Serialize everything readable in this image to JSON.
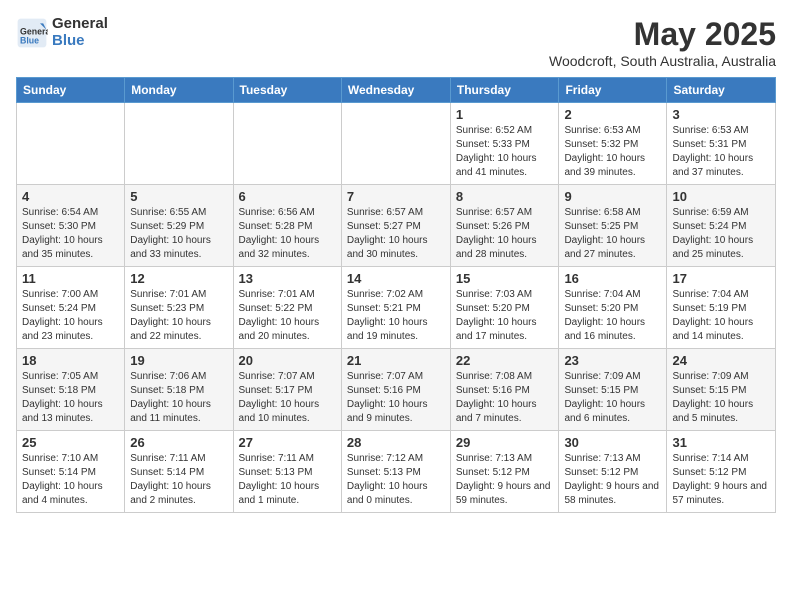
{
  "logo": {
    "line1": "General",
    "line2": "Blue"
  },
  "title": "May 2025",
  "subtitle": "Woodcroft, South Australia, Australia",
  "days": [
    "Sunday",
    "Monday",
    "Tuesday",
    "Wednesday",
    "Thursday",
    "Friday",
    "Saturday"
  ],
  "weeks": [
    [
      {
        "day": "",
        "info": ""
      },
      {
        "day": "",
        "info": ""
      },
      {
        "day": "",
        "info": ""
      },
      {
        "day": "",
        "info": ""
      },
      {
        "day": "1",
        "info": "Sunrise: 6:52 AM\nSunset: 5:33 PM\nDaylight: 10 hours and 41 minutes."
      },
      {
        "day": "2",
        "info": "Sunrise: 6:53 AM\nSunset: 5:32 PM\nDaylight: 10 hours and 39 minutes."
      },
      {
        "day": "3",
        "info": "Sunrise: 6:53 AM\nSunset: 5:31 PM\nDaylight: 10 hours and 37 minutes."
      }
    ],
    [
      {
        "day": "4",
        "info": "Sunrise: 6:54 AM\nSunset: 5:30 PM\nDaylight: 10 hours and 35 minutes."
      },
      {
        "day": "5",
        "info": "Sunrise: 6:55 AM\nSunset: 5:29 PM\nDaylight: 10 hours and 33 minutes."
      },
      {
        "day": "6",
        "info": "Sunrise: 6:56 AM\nSunset: 5:28 PM\nDaylight: 10 hours and 32 minutes."
      },
      {
        "day": "7",
        "info": "Sunrise: 6:57 AM\nSunset: 5:27 PM\nDaylight: 10 hours and 30 minutes."
      },
      {
        "day": "8",
        "info": "Sunrise: 6:57 AM\nSunset: 5:26 PM\nDaylight: 10 hours and 28 minutes."
      },
      {
        "day": "9",
        "info": "Sunrise: 6:58 AM\nSunset: 5:25 PM\nDaylight: 10 hours and 27 minutes."
      },
      {
        "day": "10",
        "info": "Sunrise: 6:59 AM\nSunset: 5:24 PM\nDaylight: 10 hours and 25 minutes."
      }
    ],
    [
      {
        "day": "11",
        "info": "Sunrise: 7:00 AM\nSunset: 5:24 PM\nDaylight: 10 hours and 23 minutes."
      },
      {
        "day": "12",
        "info": "Sunrise: 7:01 AM\nSunset: 5:23 PM\nDaylight: 10 hours and 22 minutes."
      },
      {
        "day": "13",
        "info": "Sunrise: 7:01 AM\nSunset: 5:22 PM\nDaylight: 10 hours and 20 minutes."
      },
      {
        "day": "14",
        "info": "Sunrise: 7:02 AM\nSunset: 5:21 PM\nDaylight: 10 hours and 19 minutes."
      },
      {
        "day": "15",
        "info": "Sunrise: 7:03 AM\nSunset: 5:20 PM\nDaylight: 10 hours and 17 minutes."
      },
      {
        "day": "16",
        "info": "Sunrise: 7:04 AM\nSunset: 5:20 PM\nDaylight: 10 hours and 16 minutes."
      },
      {
        "day": "17",
        "info": "Sunrise: 7:04 AM\nSunset: 5:19 PM\nDaylight: 10 hours and 14 minutes."
      }
    ],
    [
      {
        "day": "18",
        "info": "Sunrise: 7:05 AM\nSunset: 5:18 PM\nDaylight: 10 hours and 13 minutes."
      },
      {
        "day": "19",
        "info": "Sunrise: 7:06 AM\nSunset: 5:18 PM\nDaylight: 10 hours and 11 minutes."
      },
      {
        "day": "20",
        "info": "Sunrise: 7:07 AM\nSunset: 5:17 PM\nDaylight: 10 hours and 10 minutes."
      },
      {
        "day": "21",
        "info": "Sunrise: 7:07 AM\nSunset: 5:16 PM\nDaylight: 10 hours and 9 minutes."
      },
      {
        "day": "22",
        "info": "Sunrise: 7:08 AM\nSunset: 5:16 PM\nDaylight: 10 hours and 7 minutes."
      },
      {
        "day": "23",
        "info": "Sunrise: 7:09 AM\nSunset: 5:15 PM\nDaylight: 10 hours and 6 minutes."
      },
      {
        "day": "24",
        "info": "Sunrise: 7:09 AM\nSunset: 5:15 PM\nDaylight: 10 hours and 5 minutes."
      }
    ],
    [
      {
        "day": "25",
        "info": "Sunrise: 7:10 AM\nSunset: 5:14 PM\nDaylight: 10 hours and 4 minutes."
      },
      {
        "day": "26",
        "info": "Sunrise: 7:11 AM\nSunset: 5:14 PM\nDaylight: 10 hours and 2 minutes."
      },
      {
        "day": "27",
        "info": "Sunrise: 7:11 AM\nSunset: 5:13 PM\nDaylight: 10 hours and 1 minute."
      },
      {
        "day": "28",
        "info": "Sunrise: 7:12 AM\nSunset: 5:13 PM\nDaylight: 10 hours and 0 minutes."
      },
      {
        "day": "29",
        "info": "Sunrise: 7:13 AM\nSunset: 5:12 PM\nDaylight: 9 hours and 59 minutes."
      },
      {
        "day": "30",
        "info": "Sunrise: 7:13 AM\nSunset: 5:12 PM\nDaylight: 9 hours and 58 minutes."
      },
      {
        "day": "31",
        "info": "Sunrise: 7:14 AM\nSunset: 5:12 PM\nDaylight: 9 hours and 57 minutes."
      }
    ]
  ]
}
